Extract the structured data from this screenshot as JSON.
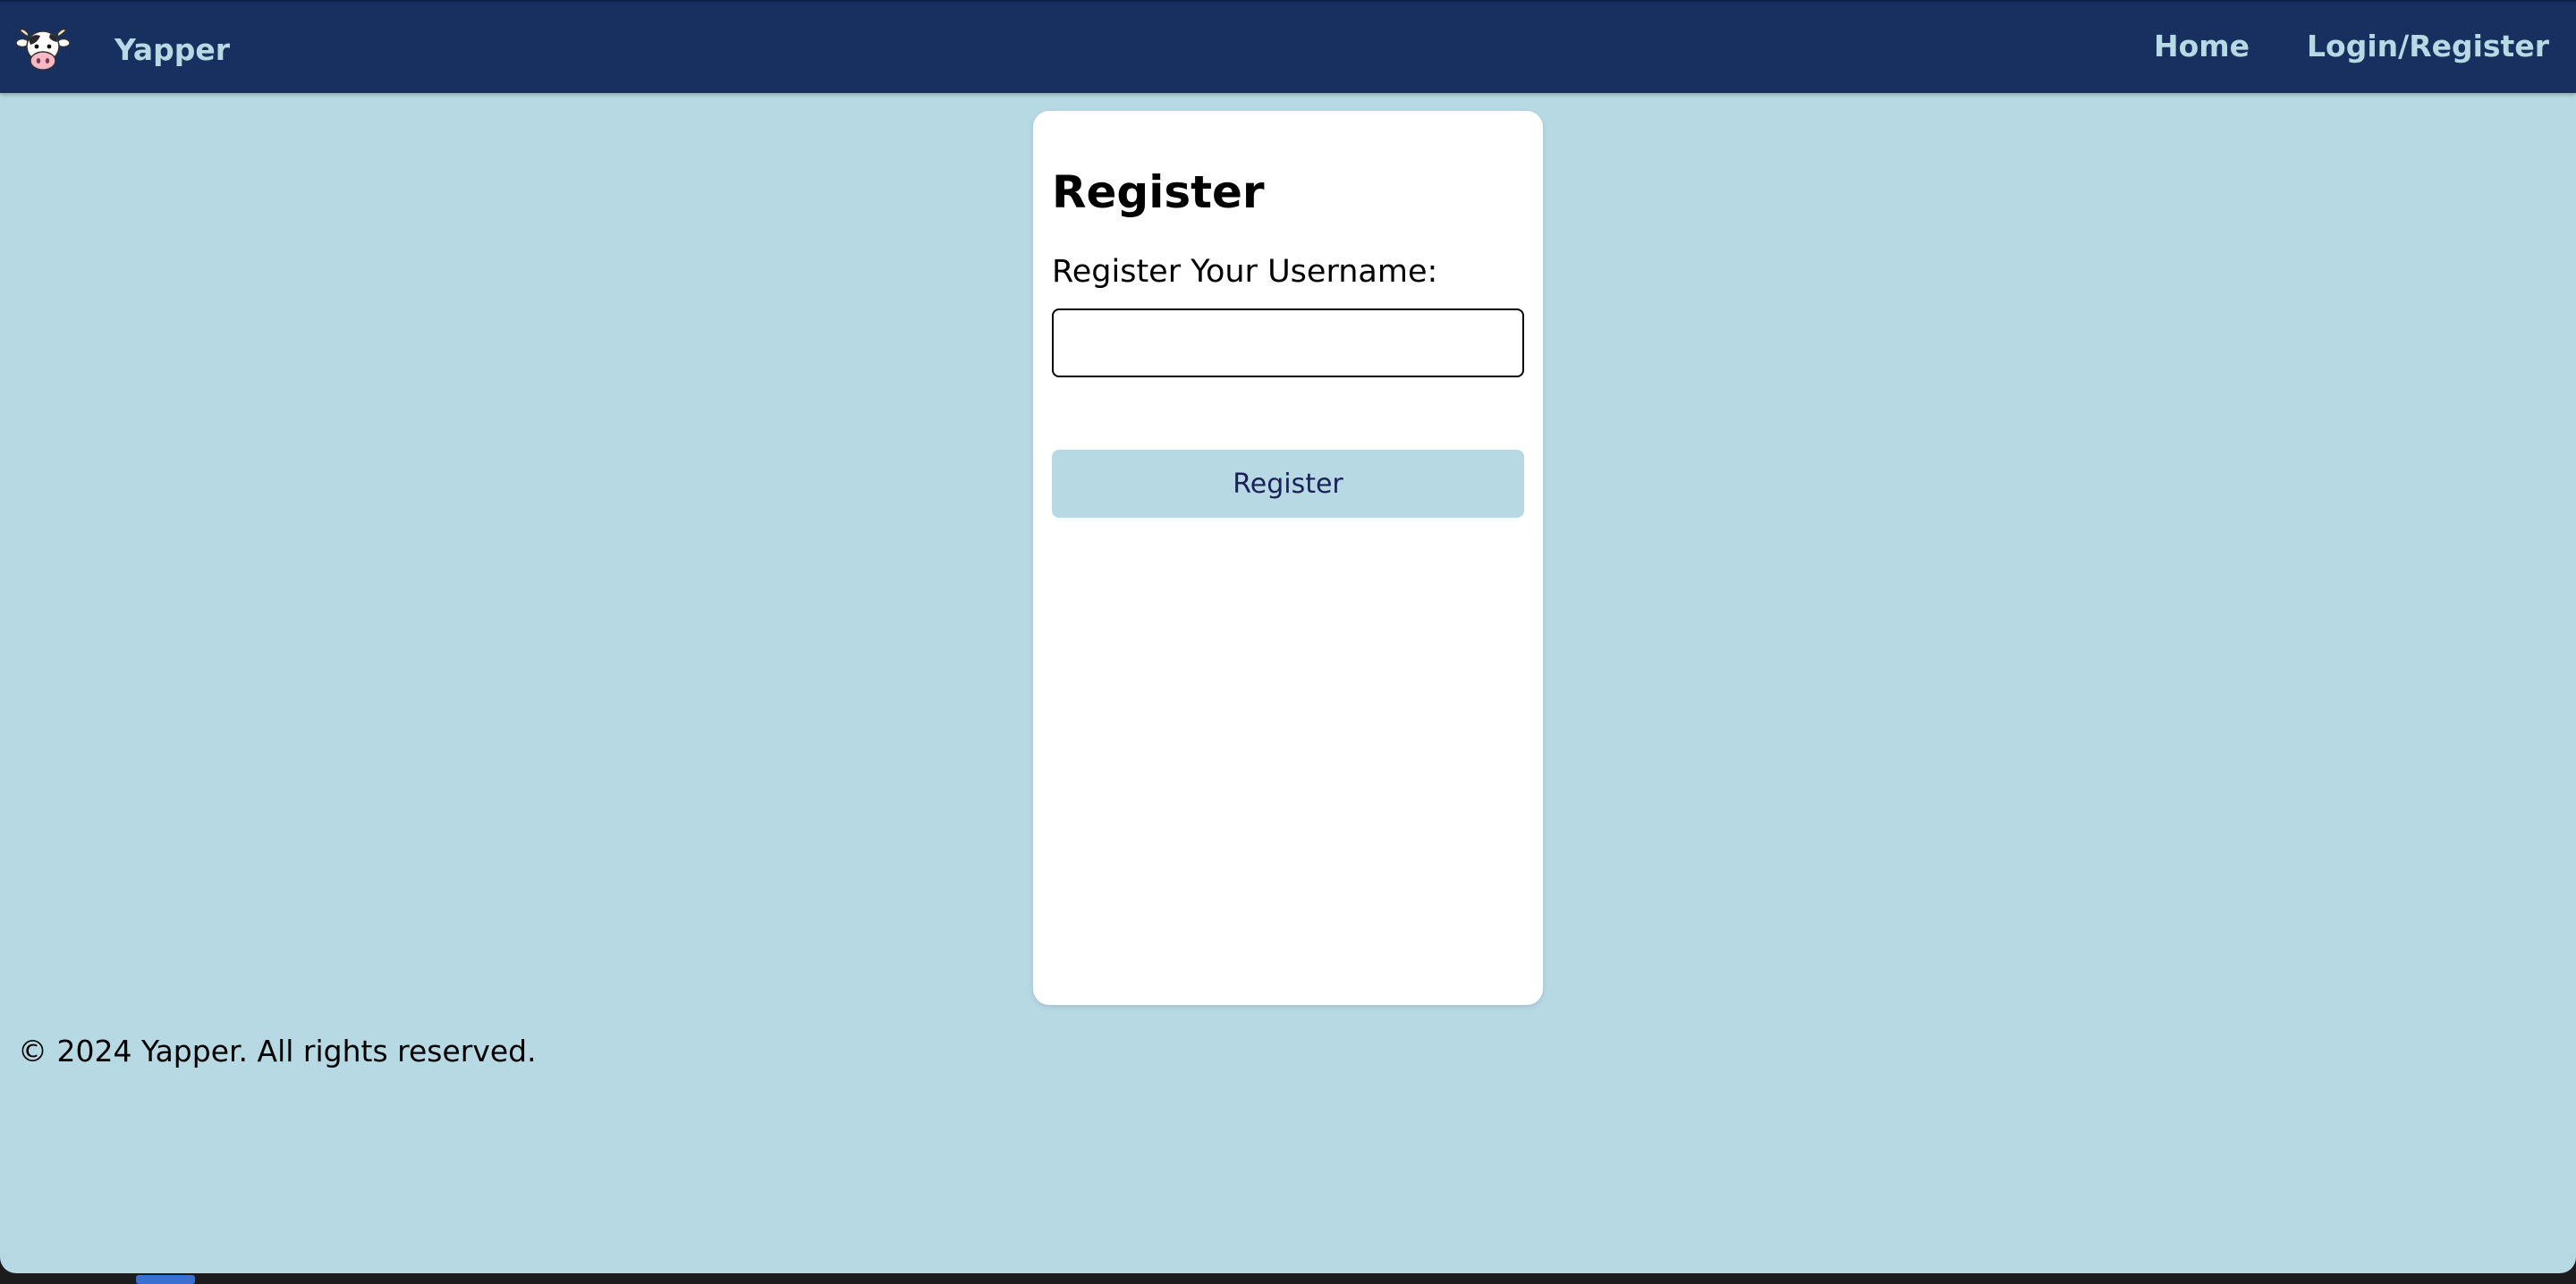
{
  "navbar": {
    "logo_icon": "cow-icon",
    "brand_name": "Yapper",
    "links": [
      {
        "label": "Home"
      },
      {
        "label": "Login/Register"
      }
    ]
  },
  "register_card": {
    "title": "Register",
    "username_label": "Register Your Username:",
    "username_value": "",
    "submit_label": "Register"
  },
  "footer": {
    "text": "© 2024 Yapper. All rights reserved."
  },
  "colors": {
    "navbar_bg": "#17305f",
    "nav_text": "#b7d9e4",
    "page_bg": "#b7d9e4",
    "card_bg": "#ffffff",
    "button_bg": "#b7d9e4",
    "button_text": "#1b2158"
  }
}
